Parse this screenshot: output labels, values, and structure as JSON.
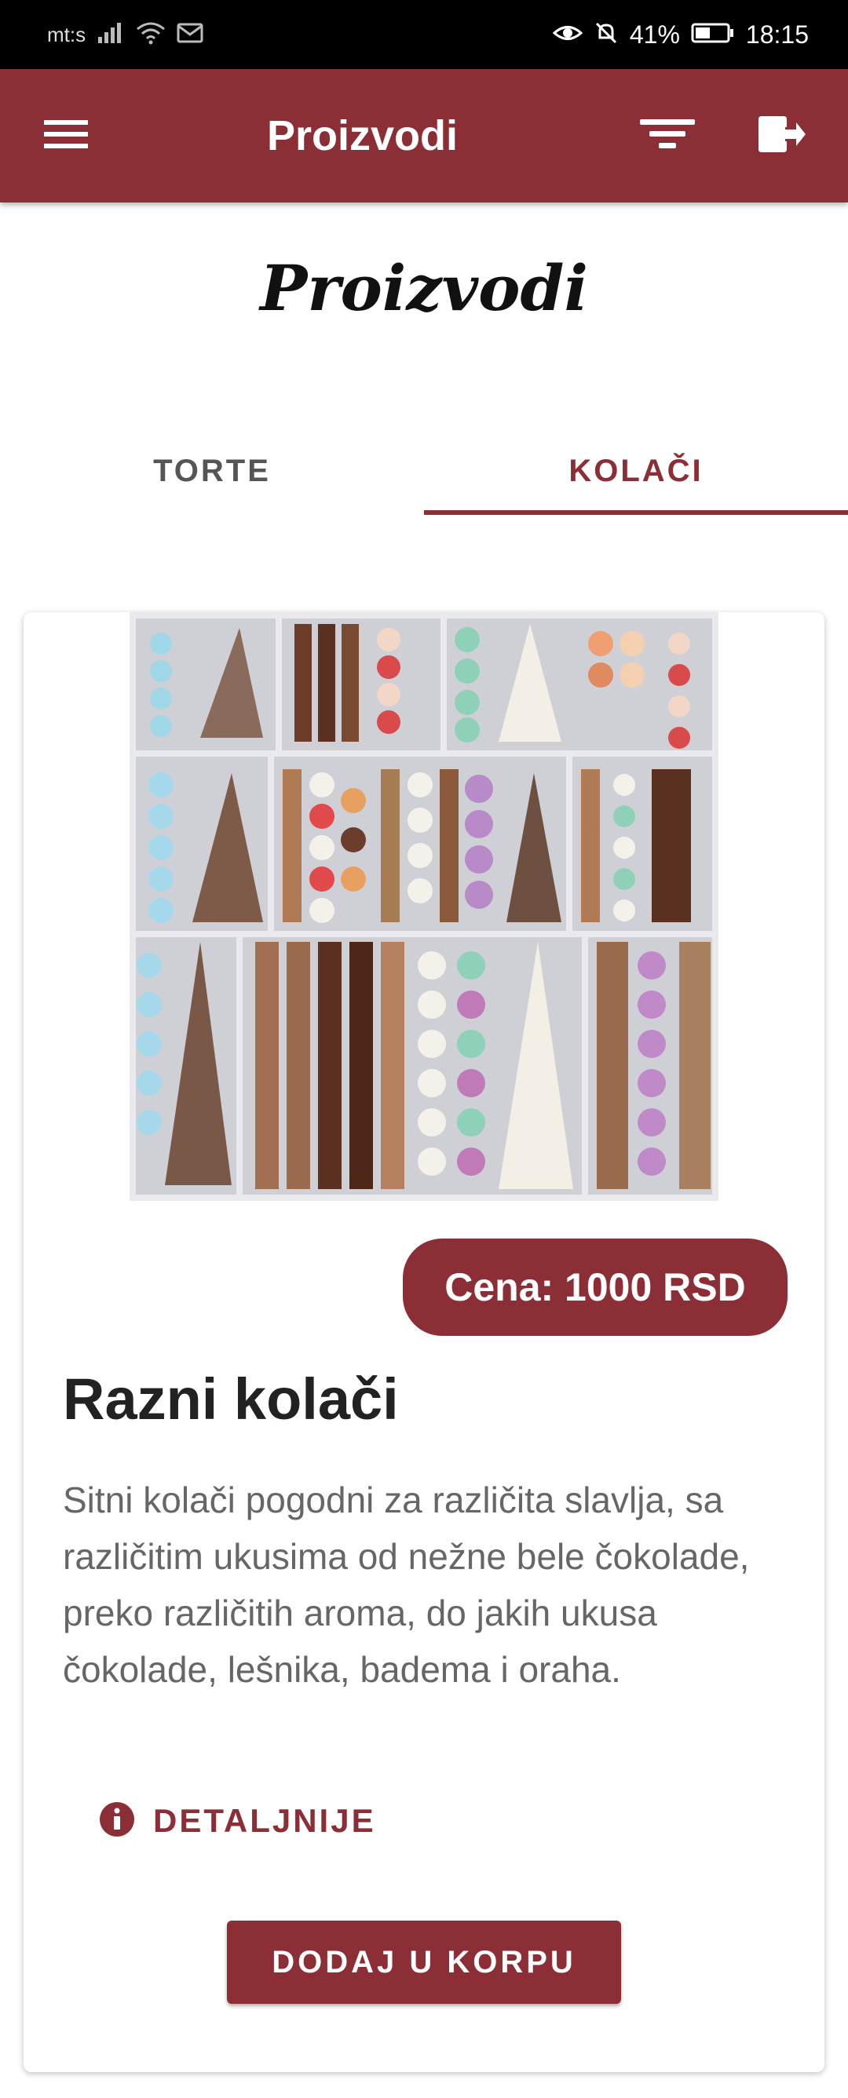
{
  "status_bar": {
    "carrier": "mt:s",
    "battery": "41%",
    "time": "18:15",
    "icons": [
      "signal-icon",
      "wifi-icon",
      "mail-icon",
      "eye-icon",
      "bell-off-icon",
      "battery-icon"
    ]
  },
  "app_bar": {
    "title": "Proizvodi",
    "menu_icon": "menu-icon",
    "filter_icon": "filter-icon",
    "logout_icon": "logout-icon",
    "color": "#8b2e35"
  },
  "page": {
    "heading": "Proizvodi"
  },
  "tabs": [
    {
      "label": "TORTE",
      "active": false
    },
    {
      "label": "KOLAČI",
      "active": true
    }
  ],
  "product": {
    "image_alt": "Razni kolači",
    "price": "Cena: 1000 RSD",
    "title": "Razni kolači",
    "description": "Sitni kolači pogodni za različita slavlja, sa različitim ukusima od nežne bele čokolade, preko različitih aroma, do jakih ukusa čokolade, lešnika, badema i oraha.",
    "details_label": "DETALJNIJE",
    "add_to_cart_label": "DODAJ U KORPU"
  },
  "colors": {
    "accent": "#8b2e35",
    "text_dark": "#222222",
    "text_muted": "#666666"
  }
}
